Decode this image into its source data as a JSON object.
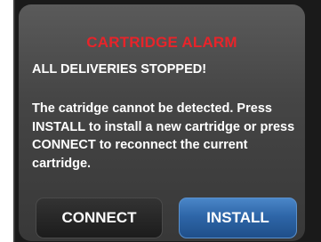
{
  "alarm": {
    "title": "CARTRIDGE ALARM",
    "subtitle": "ALL DELIVERIES STOPPED!",
    "message": "The catridge cannot be detected. Press INSTALL to install a new cartridge or press CONNECT to reconnect the current cartridge."
  },
  "buttons": {
    "connect_label": "CONNECT",
    "install_label": "INSTALL"
  },
  "colors": {
    "alarm_red": "#e8242a",
    "install_blue": "#2e66a8",
    "panel_gray": "#454545"
  }
}
